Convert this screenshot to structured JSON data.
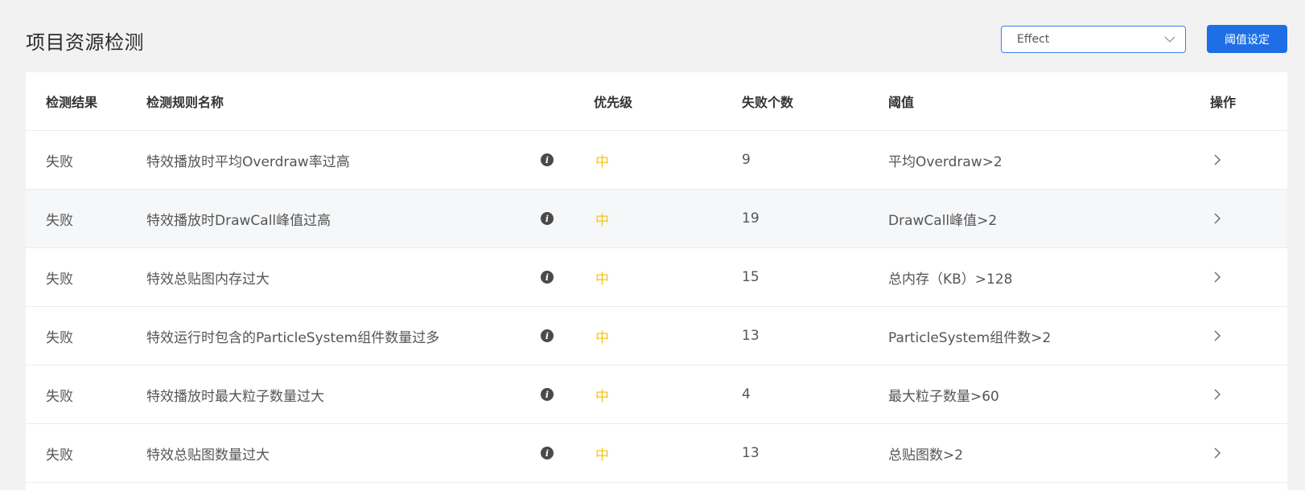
{
  "page": {
    "title": "项目资源检测"
  },
  "filter": {
    "selected": "Effect",
    "icon": "chevron-down-icon"
  },
  "actions": {
    "threshold_button": "阈值设定"
  },
  "colors": {
    "accent": "#1e6fe6",
    "priority_medium": "#f5c518",
    "background": "#f2f2f2"
  },
  "table": {
    "headers": {
      "result": "检测结果",
      "name": "检测规则名称",
      "priority": "优先级",
      "fail_count": "失败个数",
      "threshold": "阈值",
      "operation": "操作"
    },
    "rows": [
      {
        "result": "失败",
        "name": "特效播放时平均Overdraw率过高",
        "priority": "中",
        "fail_count": "9",
        "threshold": "平均Overdraw>2"
      },
      {
        "result": "失败",
        "name": "特效播放时DrawCall峰值过高",
        "priority": "中",
        "fail_count": "19",
        "threshold": "DrawCall峰值>2"
      },
      {
        "result": "失败",
        "name": "特效总贴图内存过大",
        "priority": "中",
        "fail_count": "15",
        "threshold": "总内存（KB）>128"
      },
      {
        "result": "失败",
        "name": "特效运行时包含的ParticleSystem组件数量过多",
        "priority": "中",
        "fail_count": "13",
        "threshold": "ParticleSystem组件数>2"
      },
      {
        "result": "失败",
        "name": "特效播放时最大粒子数量过大",
        "priority": "中",
        "fail_count": "4",
        "threshold": "最大粒子数量>60"
      },
      {
        "result": "失败",
        "name": "特效总贴图数量过大",
        "priority": "中",
        "fail_count": "13",
        "threshold": "总贴图数>2"
      }
    ],
    "info_icon": "info-icon",
    "row_action_icon": "chevron-right-icon"
  }
}
